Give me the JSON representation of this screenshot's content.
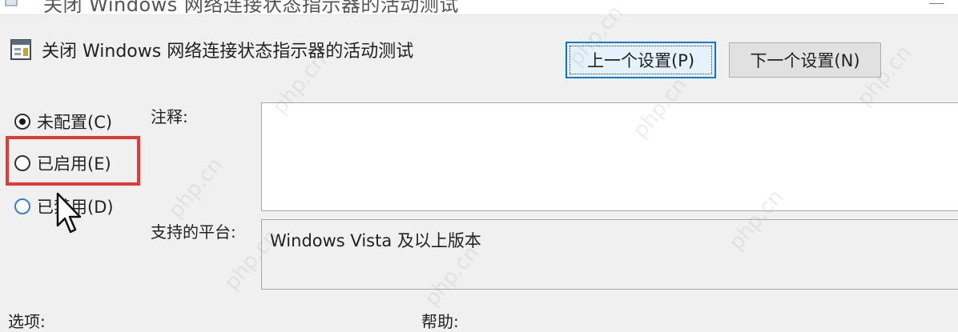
{
  "window": {
    "title": "关闭 Windows 网络连接状态指示器的活动测试",
    "icon": "policy-icon"
  },
  "header": {
    "title": "关闭 Windows 网络连接状态指示器的活动测试",
    "icon": "policy-icon"
  },
  "nav": {
    "prev_label": "上一个设置(P)",
    "next_label": "下一个设置(N)"
  },
  "options": {
    "not_configured": "未配置(C)",
    "enabled": "已启用(E)",
    "disabled": "已禁用(D)",
    "selected": "not_configured"
  },
  "fields": {
    "comment_label": "注释:",
    "comment_value": "",
    "platform_label": "支持的平台:",
    "platform_value": "Windows Vista 及以上版本"
  },
  "sections": {
    "options_label": "选项:",
    "help_label": "帮助:"
  },
  "watermark": "php.cn",
  "colors": {
    "highlight": "#e53935",
    "focus": "#0078d7",
    "background": "#f0f0f0"
  }
}
